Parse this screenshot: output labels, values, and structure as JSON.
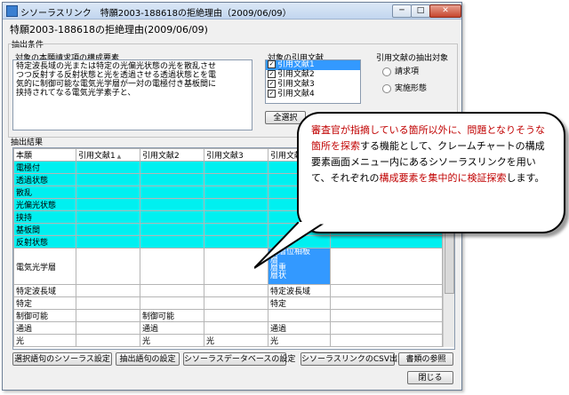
{
  "window": {
    "title": "シソーラスリンク　特願2003-188618の拒絶理由（2009/06/09）",
    "minimize": "─",
    "maximize": "□",
    "close": "✕"
  },
  "header_title": "特願2003-188618の拒絶理由(2009/06/09)",
  "extraction": {
    "label": "抽出条件",
    "claim_label": "対象の本願請求項の構成要素",
    "claim_text": "特定波長域の光または特定の光偏光状態の光を散乱させ\nつつ反射する反射状態と光を透過させる透過状態とを電\n気的に制御可能な電気光学層が一対の電極付き基板間に\n挟持されてなる電気光学素子と、",
    "cited_label": "対象の引用文献",
    "cited_items": [
      {
        "label": "引用文献1",
        "checked": true,
        "selected": true
      },
      {
        "label": "引用文献2",
        "checked": true,
        "selected": false
      },
      {
        "label": "引用文献3",
        "checked": true,
        "selected": false
      },
      {
        "label": "引用文献4",
        "checked": true,
        "selected": false
      }
    ],
    "select_all": "全選択",
    "target_label": "引用文献の抽出対象",
    "radio1": "請求項",
    "radio2": "実施形態"
  },
  "results": {
    "label": "抽出結果",
    "columns": [
      "本願",
      "引用文献1",
      "引用文献2",
      "引用文献3",
      "引用文献4"
    ],
    "sort_mark": "▲",
    "rows": [
      {
        "name": "電極付",
        "c1": "",
        "c2": "",
        "c3": "",
        "c4": "",
        "cyan": true
      },
      {
        "name": "透過状態",
        "c1": "",
        "c2": "",
        "c3": "",
        "c4": "",
        "cyan": true
      },
      {
        "name": "散乱",
        "c1": "",
        "c2": "",
        "c3": "",
        "c4": "",
        "cyan": true
      },
      {
        "name": "光偏光状態",
        "c1": "",
        "c2": "",
        "c3": "",
        "c4": "",
        "cyan": true
      },
      {
        "name": "挟持",
        "c1": "",
        "c2": "",
        "c3": "",
        "c4": "",
        "cyan": true
      },
      {
        "name": "基板間",
        "c1": "",
        "c2": "",
        "c3": "",
        "c4": "",
        "cyan": true
      },
      {
        "name": "反射状態",
        "c1": "",
        "c2": "",
        "c3": "",
        "c4": "",
        "cyan": true
      },
      {
        "name": "電気光学層",
        "c1": "",
        "c2": "",
        "c3": "",
        "c4": "積層位相板\n層\n層重\n層状",
        "tall": true,
        "sel4": true
      },
      {
        "name": "特定波長域",
        "c1": "",
        "c2": "",
        "c3": "",
        "c4": "特定波長域"
      },
      {
        "name": "特定",
        "c1": "",
        "c2": "",
        "c3": "",
        "c4": "特定"
      },
      {
        "name": "制御可能",
        "c1": "",
        "c2": "制御可能",
        "c3": "",
        "c4": ""
      },
      {
        "name": "通過",
        "c1": "",
        "c2": "通過",
        "c3": "",
        "c4": "通過"
      },
      {
        "name": "光",
        "c1": "",
        "c2": "光",
        "c3": "光",
        "c4": "光"
      }
    ]
  },
  "buttons": {
    "b1": "選択語句のシソーラス設定",
    "b2": "抽出語句の設定",
    "b3": "シソーラスデータベースの設定",
    "b4": "シソーラスリンクのCSV出力",
    "b5": "書類の参照",
    "close": "閉じる"
  },
  "callout": {
    "p1": "審査官が指摘している箇所以外に、",
    "p2": "問題とな",
    "p3": "りそうな箇所を探索",
    "p4": "する機能として、クレーム",
    "p5": "チャートの構成要素画面メニュー内にあるシ",
    "p6": "ソーラスリンクを用いて、それぞれの",
    "p7": "構成要",
    "p8": "素を集中的に検証探索",
    "p9": "します。"
  },
  "colors": {
    "highlight": "#00f0f0",
    "selection": "#3399ff",
    "emphasis": "#c00000"
  }
}
